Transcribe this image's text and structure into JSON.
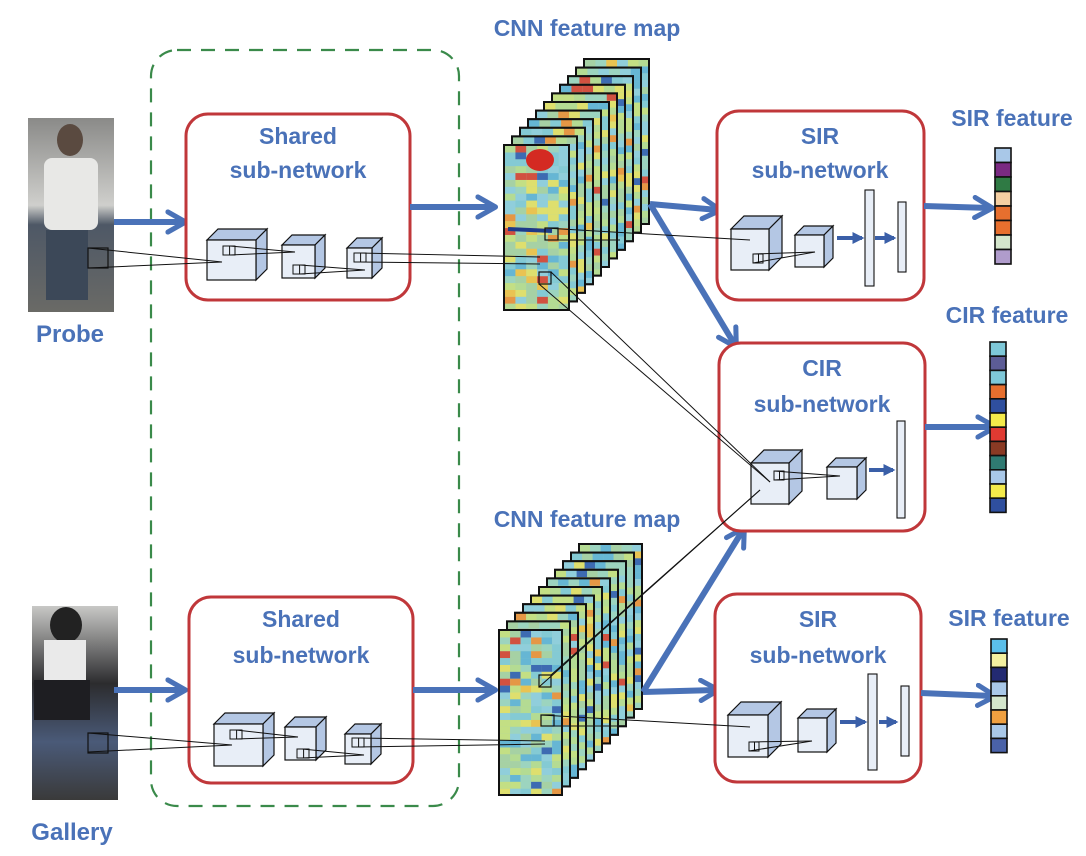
{
  "colors": {
    "text_blue": "#4a72b8",
    "arrow_blue": "#4a72b8",
    "box_red": "#c0373a",
    "dashed_green": "#3a8a4a",
    "cube_front": "#e8eef7",
    "cube_side": "#b4c7e4"
  },
  "labels": {
    "probe": "Probe",
    "gallery": "Gallery",
    "cnn_top": "CNN feature map",
    "cnn_bottom": "CNN feature map",
    "sir_feature_top": "SIR feature",
    "cir_feature": "CIR feature",
    "sir_feature_bottom": "SIR feature"
  },
  "boxes": {
    "shared_top": {
      "line1": "Shared",
      "line2": "sub-network"
    },
    "shared_bottom": {
      "line1": "Shared",
      "line2": "sub-network"
    },
    "sir_top": {
      "line1": "SIR",
      "line2": "sub-network"
    },
    "cir": {
      "line1": "CIR",
      "line2": "sub-network"
    },
    "sir_bottom": {
      "line1": "SIR",
      "line2": "sub-network"
    }
  },
  "feature_vectors": {
    "sir_top": [
      "#a9c8e8",
      "#7a2a82",
      "#2f7a44",
      "#f5cfa2",
      "#e76f2e",
      "#e76f2e",
      "#d4e6cc",
      "#b09ccc"
    ],
    "cir": [
      "#7ec8d8",
      "#5c5c96",
      "#7ec8d8",
      "#e76f2e",
      "#2f4f9e",
      "#f4ea4a",
      "#e03a32",
      "#8a3a24",
      "#2f7a72",
      "#a9c8e8",
      "#f4ea4a",
      "#2f4f9e"
    ],
    "sir_bottom": [
      "#5bbfea",
      "#f4f0a0",
      "#232a72",
      "#a9c8e8",
      "#d4e6cc",
      "#f0a040",
      "#a9c8e8",
      "#4a62a8"
    ]
  }
}
